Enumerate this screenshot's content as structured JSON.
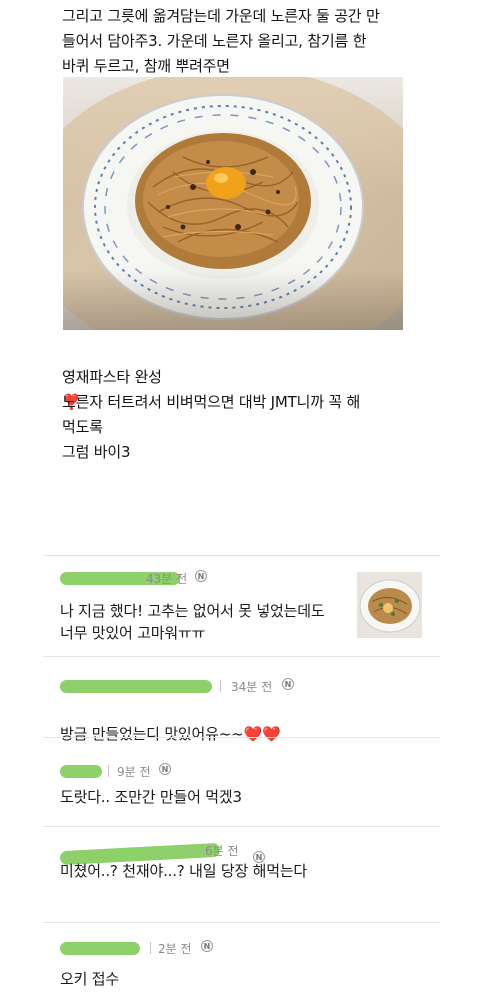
{
  "post": {
    "text_top": "그리고 그릇에 옮겨담는데 가운데 노른자 둘 공간 만\n들어서 담아주3. 가운데 노른자 올리고, 참기름 한\n바퀴 두르고, 참깨 뿌려주면",
    "finish_label": "영재파스타 완성",
    "finish_emoji": "❣️",
    "text_bottom": "노른자 터트려서 비벼먹으면 대박 JMT니까 꼭 해\n먹도록\n그럼 바이3"
  },
  "comments": [
    {
      "time": "43분 전",
      "badge": "N",
      "body": "나 지금 했다! 고추는 없어서 못 넣었는데도\n너무 맛있어 고마워ㅠㅠ",
      "has_thumb": true
    },
    {
      "time": "34분 전",
      "badge": "N",
      "body": "방금 만들었는디 맛있어유~~",
      "hearts": "❤️❤️"
    },
    {
      "time": "9분 전",
      "badge": "N",
      "body": "도랏다.. 조만간 만들어 먹겠3"
    },
    {
      "time": "6분 전",
      "badge": "N",
      "body": "미쳤어..? 천재야...? 내일 당장 해먹는다"
    },
    {
      "time": "2분 전",
      "badge": "N",
      "body": "오키 접수"
    }
  ]
}
